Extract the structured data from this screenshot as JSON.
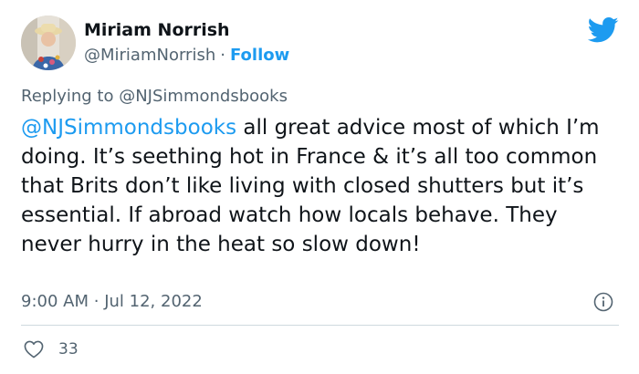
{
  "author": {
    "display_name": "Miriam Norrish",
    "handle": "@MiriamNorrish",
    "separator": "·",
    "follow_label": "Follow"
  },
  "reply": {
    "prefix": "Replying to",
    "handle": "@NJSimmondsbooks"
  },
  "tweet": {
    "mention": "@NJSimmondsbooks",
    "text": " all great advice most of which I’m doing. It’s seething hot in France & it’s all too common that Brits don’t like living with closed shutters but it’s essential. If abroad watch how locals behave. They never hurry in the heat so slow down!"
  },
  "meta": {
    "time": "9:00 AM",
    "separator": "·",
    "date": "Jul 12, 2022"
  },
  "engagement": {
    "likes": "33"
  },
  "icons": {
    "brand": "twitter-bird-icon",
    "info": "info-icon",
    "like": "heart-icon"
  },
  "colors": {
    "accent": "#1d9bf0",
    "text": "#0f1419",
    "secondary": "#536471",
    "divider": "#cfd9de"
  }
}
